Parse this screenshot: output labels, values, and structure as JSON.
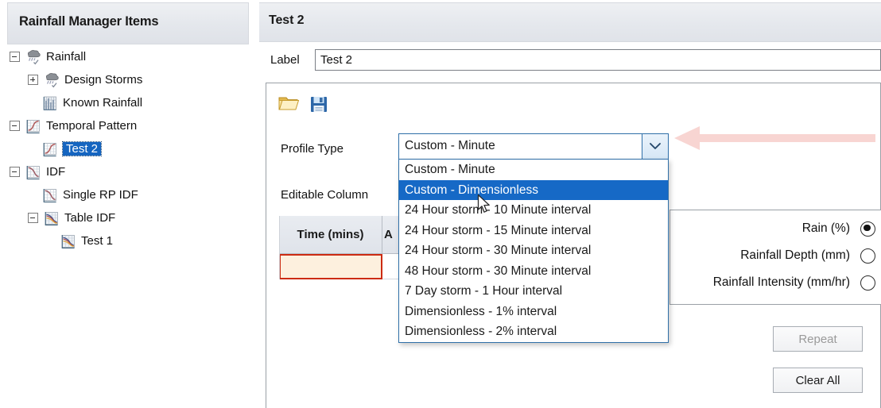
{
  "left_panel": {
    "header_title": "Rainfall Manager Items",
    "tree": [
      {
        "label": "Rainfall",
        "indent": 0,
        "expander": "minus",
        "icon": "rain-cloud-icon",
        "selected": false
      },
      {
        "label": "Design Storms",
        "indent": 1,
        "expander": "plus",
        "icon": "rain-cloud-icon",
        "selected": false
      },
      {
        "label": "Known Rainfall",
        "indent": 1,
        "expander": "none",
        "icon": "rain-bars-icon",
        "selected": false
      },
      {
        "label": "Temporal Pattern",
        "indent": 0,
        "expander": "minus",
        "icon": "s-curve-chart-icon",
        "selected": false
      },
      {
        "label": "Test 2",
        "indent": 1,
        "expander": "none",
        "icon": "s-curve-chart-icon",
        "selected": true
      },
      {
        "label": "IDF",
        "indent": 0,
        "expander": "minus",
        "icon": "decay-curve-icon",
        "selected": false
      },
      {
        "label": "Single RP IDF",
        "indent": 1,
        "expander": "none",
        "icon": "decay-curve-icon",
        "selected": false
      },
      {
        "label": "Table IDF",
        "indent": 1,
        "expander": "minus",
        "icon": "multi-curve-icon",
        "selected": false
      },
      {
        "label": "Test 1",
        "indent": 2,
        "expander": "none",
        "icon": "multi-curve-icon",
        "selected": false
      }
    ]
  },
  "main": {
    "header_title": "Test 2",
    "label_caption": "Label",
    "label_value": "Test 2",
    "toolbar": {
      "open_title": "Open",
      "save_title": "Save"
    },
    "profile_type": {
      "caption": "Profile Type",
      "value": "Custom - Minute",
      "expanded": true,
      "options": [
        "Custom - Minute",
        "Custom - Dimensionless",
        "24 Hour storm - 10 Minute interval",
        "24 Hour storm - 15 Minute interval",
        "24 Hour storm - 30 Minute interval",
        "48 Hour storm - 30 Minute interval",
        "7 Day storm - 1 Hour interval",
        "Dimensionless - 1% interval",
        "Dimensionless - 2% interval"
      ],
      "highlighted_option": "Custom - Dimensionless"
    },
    "editable_column": {
      "caption": "Editable Column"
    },
    "table": {
      "columns": [
        "Time (mins)",
        "A"
      ],
      "rows": [
        [
          "",
          ""
        ]
      ]
    },
    "units_group": {
      "options": [
        {
          "label": "Rain (%)",
          "selected": true
        },
        {
          "label": "Rainfall Depth (mm)",
          "selected": false
        },
        {
          "label": "Rainfall Intensity (mm/hr)",
          "selected": false
        }
      ]
    },
    "buttons": {
      "repeat": "Repeat",
      "repeat_disabled": true,
      "clear_all": "Clear All"
    }
  },
  "colors": {
    "accent": "#1669c6",
    "combo_border": "#2f6fa8",
    "cell_highlight_border": "#cc2b12",
    "cell_highlight_fill": "#fdf0de",
    "annotation_arrow": "#f3b3ae"
  }
}
